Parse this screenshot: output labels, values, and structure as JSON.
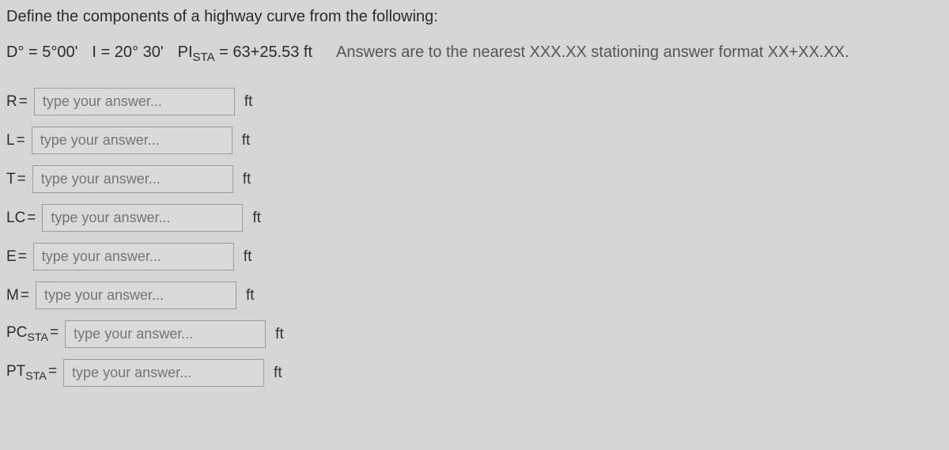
{
  "header": "Define the components of a highway curve from the following:",
  "params": {
    "d": "D° = 5°00'",
    "i": "I = 20° 30'",
    "pi": "PI",
    "pi_sub": "STA",
    "pi_val": " = 63+25.53 ft",
    "note": "Answers are to the nearest XXX.XX stationing answer format XX+XX.XX."
  },
  "placeholder": "type your answer...",
  "rows": [
    {
      "label": "R",
      "unit": "ft"
    },
    {
      "label": "L",
      "unit": "ft"
    },
    {
      "label": "T",
      "unit": "ft"
    },
    {
      "label": "LC",
      "unit": "ft"
    },
    {
      "label": "E",
      "unit": "ft"
    },
    {
      "label": "M",
      "unit": "ft"
    },
    {
      "label": "PC",
      "sub": "STA",
      "unit": "ft"
    },
    {
      "label": "PT",
      "sub": "STA",
      "unit": "ft"
    }
  ]
}
